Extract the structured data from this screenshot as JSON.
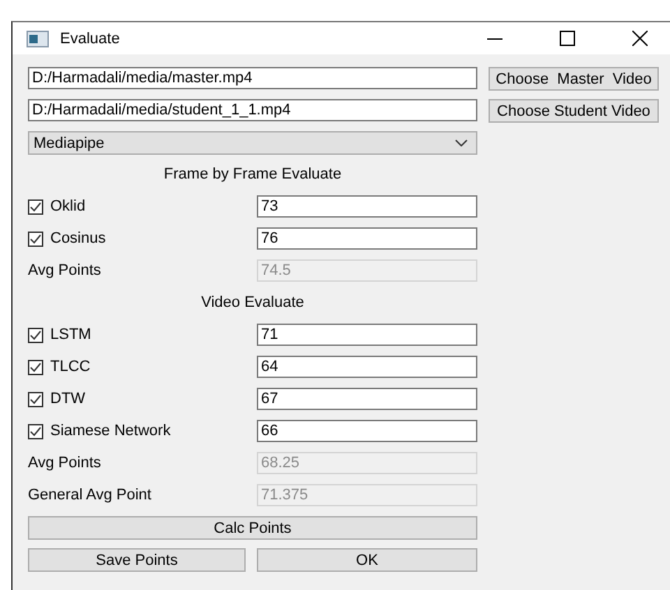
{
  "window": {
    "title": "Evaluate"
  },
  "files": [
    {
      "path": "D:/Harmadali/media/master.mp4",
      "button": "Choose  Master  Video"
    },
    {
      "path": "D:/Harmadali/media/student_1_1.mp4",
      "button": "Choose Student Video"
    }
  ],
  "method_dropdown": {
    "value": "Mediapipe"
  },
  "rows": [
    {
      "kind": "section",
      "label": "Frame by Frame Evaluate"
    },
    {
      "kind": "check",
      "label": "Oklid",
      "checked": true,
      "value": "73"
    },
    {
      "kind": "check",
      "label": "Cosinus",
      "checked": true,
      "value": "76"
    },
    {
      "kind": "readonly",
      "label": "Avg Points",
      "value": "74.5"
    },
    {
      "kind": "section",
      "label": "Video Evaluate"
    },
    {
      "kind": "check",
      "label": "LSTM",
      "checked": true,
      "value": "71"
    },
    {
      "kind": "check",
      "label": "TLCC",
      "checked": true,
      "value": "64"
    },
    {
      "kind": "check",
      "label": "DTW",
      "checked": true,
      "value": "67"
    },
    {
      "kind": "check",
      "label": "Siamese Network",
      "checked": true,
      "value": "66"
    },
    {
      "kind": "readonly",
      "label": "Avg Points",
      "value": "68.25"
    },
    {
      "kind": "readonly",
      "label": "General Avg Point",
      "value": "71.375"
    }
  ],
  "buttons": {
    "calc": "Calc Points",
    "save": "Save Points",
    "ok": "OK"
  }
}
